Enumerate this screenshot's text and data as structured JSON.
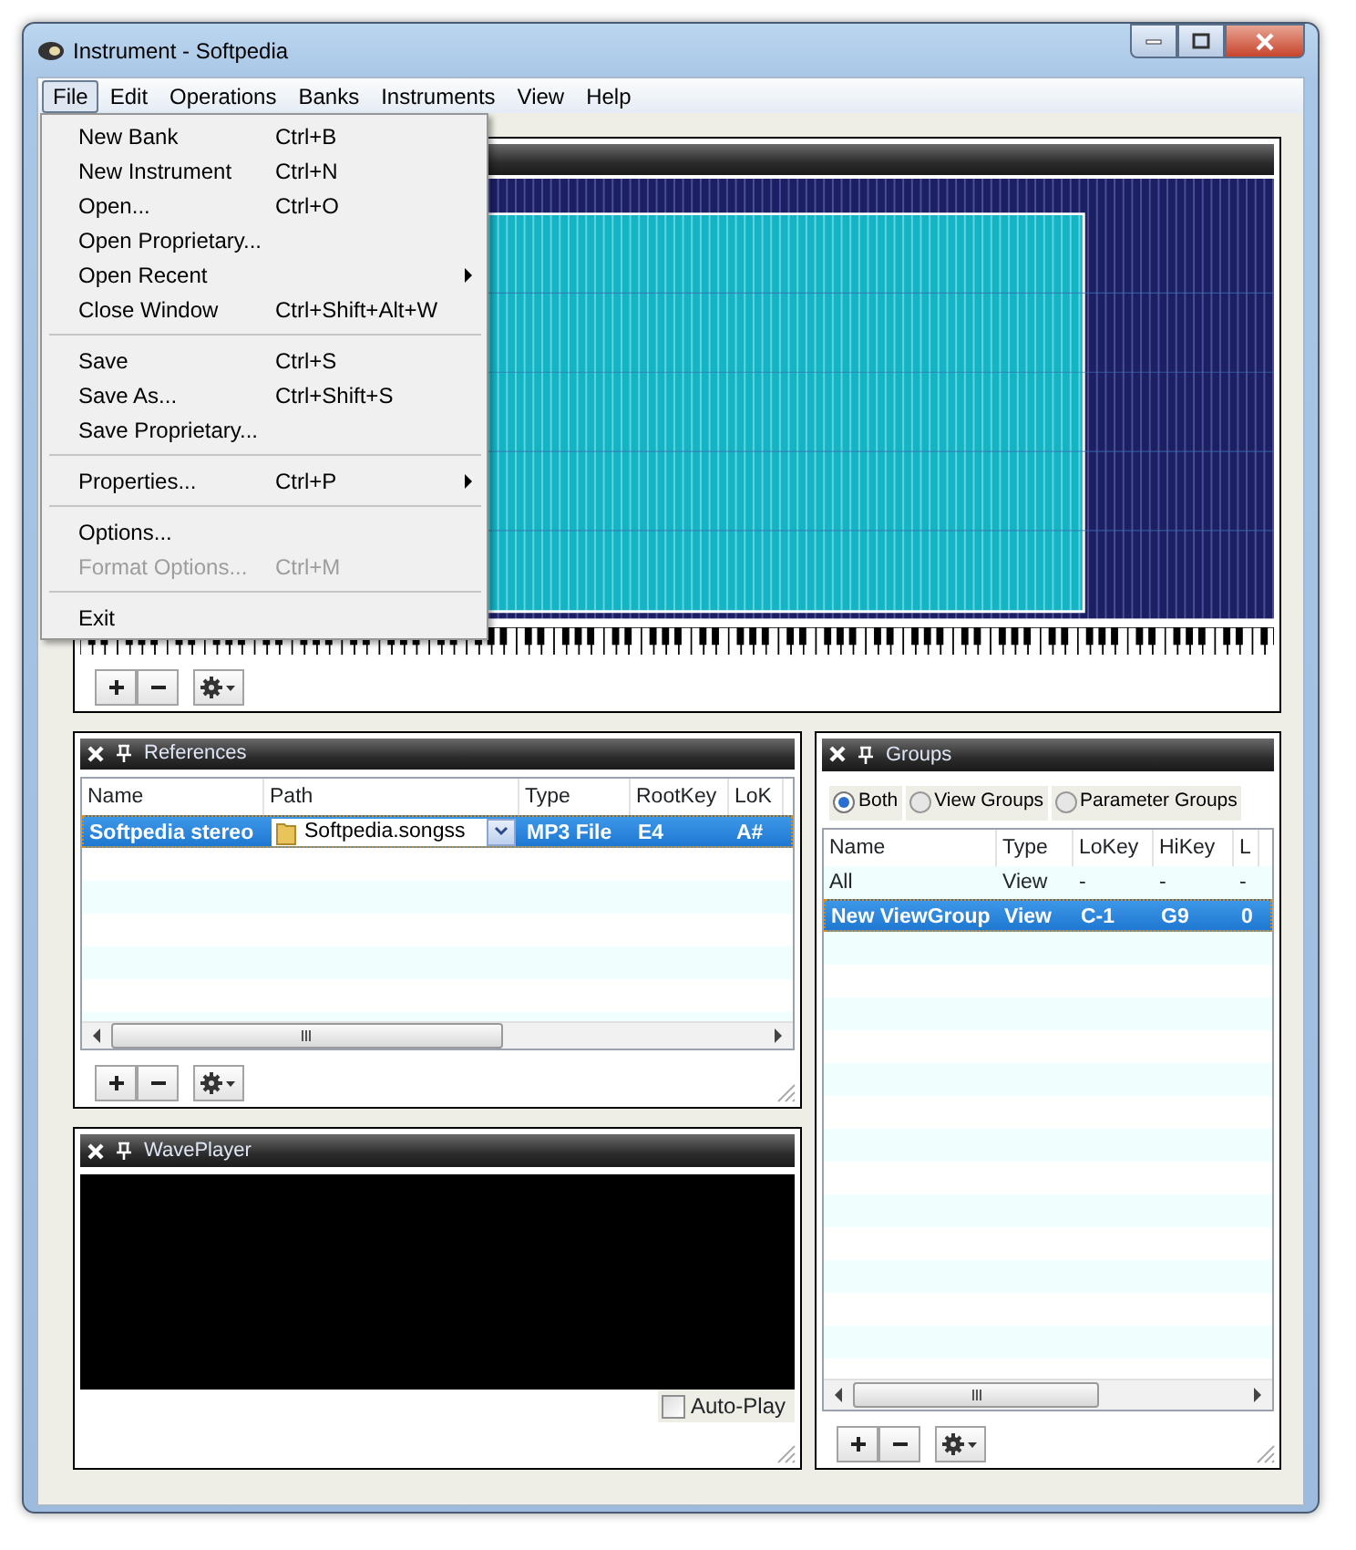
{
  "window": {
    "title": "Instrument - Softpedia"
  },
  "menu_bar": [
    {
      "label": "File",
      "selected": true
    },
    {
      "label": "Edit",
      "selected": false
    },
    {
      "label": "Operations",
      "selected": false
    },
    {
      "label": "Banks",
      "selected": false
    },
    {
      "label": "Instruments",
      "selected": false
    },
    {
      "label": "View",
      "selected": false
    },
    {
      "label": "Help",
      "selected": false
    }
  ],
  "file_menu": [
    {
      "kind": "item",
      "label": "New Bank",
      "shortcut": "Ctrl+B",
      "submenu": false,
      "disabled": false
    },
    {
      "kind": "item",
      "label": "New Instrument",
      "shortcut": "Ctrl+N",
      "submenu": false,
      "disabled": false
    },
    {
      "kind": "item",
      "label": "Open...",
      "shortcut": "Ctrl+O",
      "submenu": false,
      "disabled": false
    },
    {
      "kind": "item",
      "label": "Open Proprietary...",
      "submenu": false,
      "disabled": false
    },
    {
      "kind": "item",
      "label": "Open Recent",
      "submenu": true,
      "disabled": false
    },
    {
      "kind": "item",
      "label": "Close Window",
      "shortcut": "Ctrl+Shift+Alt+W",
      "submenu": false,
      "disabled": false
    },
    {
      "kind": "separator"
    },
    {
      "kind": "item",
      "label": "Save",
      "shortcut": "Ctrl+S",
      "submenu": false,
      "disabled": false
    },
    {
      "kind": "item",
      "label": "Save As...",
      "shortcut": "Ctrl+Shift+S",
      "submenu": false,
      "disabled": false
    },
    {
      "kind": "item",
      "label": "Save Proprietary...",
      "submenu": false,
      "disabled": false
    },
    {
      "kind": "separator"
    },
    {
      "kind": "item",
      "label": "Properties...",
      "shortcut": "Ctrl+P",
      "submenu": true,
      "disabled": false
    },
    {
      "kind": "separator"
    },
    {
      "kind": "item",
      "label": "Options...",
      "submenu": false,
      "disabled": false
    },
    {
      "kind": "item",
      "label": "Format Options...",
      "shortcut": "Ctrl+M",
      "submenu": false,
      "disabled": true
    },
    {
      "kind": "separator"
    },
    {
      "kind": "item",
      "label": "Exit",
      "submenu": false,
      "disabled": false
    }
  ],
  "references": {
    "title": "References",
    "columns": [
      "Name",
      "Path",
      "Type",
      "RootKey",
      "LoK"
    ],
    "rows": [
      {
        "selected": true,
        "cells": [
          "Softpedia stereo",
          {
            "kind": "combo",
            "text": "Softpedia.songss"
          },
          "MP3 File",
          "E4",
          "A#"
        ]
      }
    ]
  },
  "wave_player": {
    "title": "WavePlayer",
    "auto_play": {
      "label": "Auto-Play",
      "checked": false
    }
  },
  "groups": {
    "title": "Groups",
    "filters": [
      {
        "label": "Both",
        "selected": true
      },
      {
        "label": "View Groups",
        "selected": false
      },
      {
        "label": "Parameter Groups",
        "selected": false
      }
    ],
    "columns": [
      "Name",
      "Type",
      "LoKey",
      "HiKey",
      "L"
    ],
    "rows": [
      {
        "selected": false,
        "cells": [
          "All",
          "View",
          "-",
          "-",
          "-"
        ]
      },
      {
        "selected": true,
        "cells": [
          "New ViewGroup",
          "View",
          "C-1",
          "G9",
          "0"
        ]
      }
    ]
  }
}
